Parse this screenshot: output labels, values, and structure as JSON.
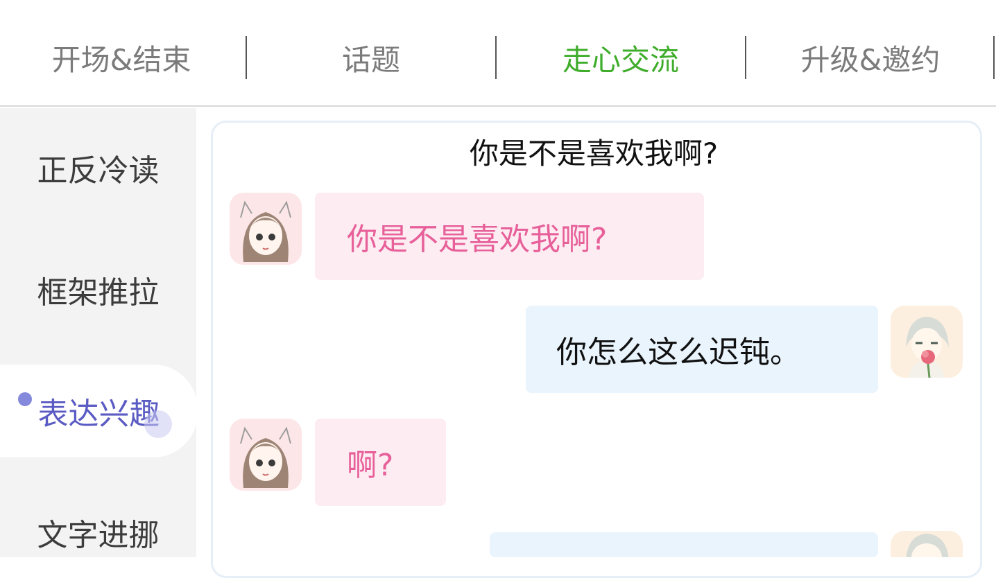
{
  "tabs": [
    {
      "label": "开场&结束",
      "active": false
    },
    {
      "label": "话题",
      "active": false
    },
    {
      "label": "走心交流",
      "active": true
    },
    {
      "label": "升级&邀约",
      "active": false
    }
  ],
  "sidebar": {
    "items": [
      {
        "label": "正反冷读"
      },
      {
        "label": "框架推拉"
      },
      {
        "label": "表达兴趣",
        "active": true
      },
      {
        "label": "文字进挪"
      }
    ]
  },
  "card": {
    "title": "你是不是喜欢我啊?",
    "messages": [
      {
        "side": "left",
        "avatar": "girl-avatar",
        "text": "你是不是喜欢我啊?"
      },
      {
        "side": "right",
        "avatar": "boy-avatar",
        "text": "你怎么这么迟钝。"
      },
      {
        "side": "left",
        "avatar": "girl-avatar",
        "text": "啊?"
      },
      {
        "side": "right",
        "avatar": "boy-avatar",
        "text": ""
      }
    ]
  },
  "colors": {
    "active_tab": "#3fad2b",
    "active_sidebar": "#5b5cc3",
    "pink_bubble": "#fdecf1",
    "pink_text": "#e7609a",
    "blue_bubble": "#eaf4fd"
  }
}
